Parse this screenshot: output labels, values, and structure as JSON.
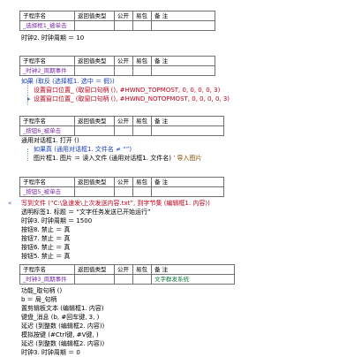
{
  "headers": {
    "name": "子程序名",
    "ret": "返回值类型",
    "pub": "公开",
    "easy": "易包",
    "note": "备 注"
  },
  "blocks": [
    {
      "sub": "_选择框1_被单击",
      "ret": "",
      "note": ""
    },
    {
      "sub": "_时钟2_周期事件",
      "ret": "",
      "note": ""
    },
    {
      "sub": "_按钮6_被单击",
      "ret": "",
      "note": ""
    },
    {
      "sub": "_按钮5_被单击",
      "ret": "",
      "note": ""
    },
    {
      "sub": "_时钟3_周期事件",
      "ret": "",
      "note": "文字群发系统"
    }
  ],
  "lines": {
    "l1": "时钟2. 时钟周期 ＝ 10",
    "l2": "如果 (取反 (选择框1. 选中 ＝ 假))",
    "l3": "设置窗口位置_ (取窗口句柄 (), #HWND_TOPMOST, 0, 0, 0, 0, 3)",
    "l4": "设置窗口位置_ (取窗口句柄 (), #HWND_NOTOPMOST, 0, 0, 0, 0, 3)",
    "l5": "通用对话框1. 打开 ()",
    "l6": "如果真 (通用对话框1. 文件名 ≠ “”)",
    "l7": "图片框1. 图片 ＝ 读入文件 (通用对话框1. 文件名)",
    "l7note": "' 导入图片",
    "l8": "写到文件 (“C:\\急速发\\上次发送内容.txt”, 到字节集 (编辑框1. 内容))",
    "l9": "透明标签1. 标题 ＝ “文字任务发送已开始运行”",
    "l10": "时钟3. 时钟周期 ＝ 1500",
    "l11": "按钮8. 禁止 ＝ 真",
    "l12": "按钮7. 禁止 ＝ 真",
    "l13": "按钮6. 禁止 ＝ 真",
    "l14": "按钮5. 禁止 ＝ 真",
    "l15": "功能_取句柄 ()",
    "l16": "b ＝ 局_句柄",
    "l17": "置剪辑板文本 (编辑框1. 内容)",
    "l18": "键盘_消息 (b, #回车键, 3, )",
    "l19": "延迟 (到整数 (编辑框2. 内容))",
    "l20": "模拟按键 (#Ctrl键, #V键, )",
    "l21": "延迟 (到整数 (编辑框2. 内容))",
    "l22": "时钟3. 时钟周期 ＝ 0"
  }
}
